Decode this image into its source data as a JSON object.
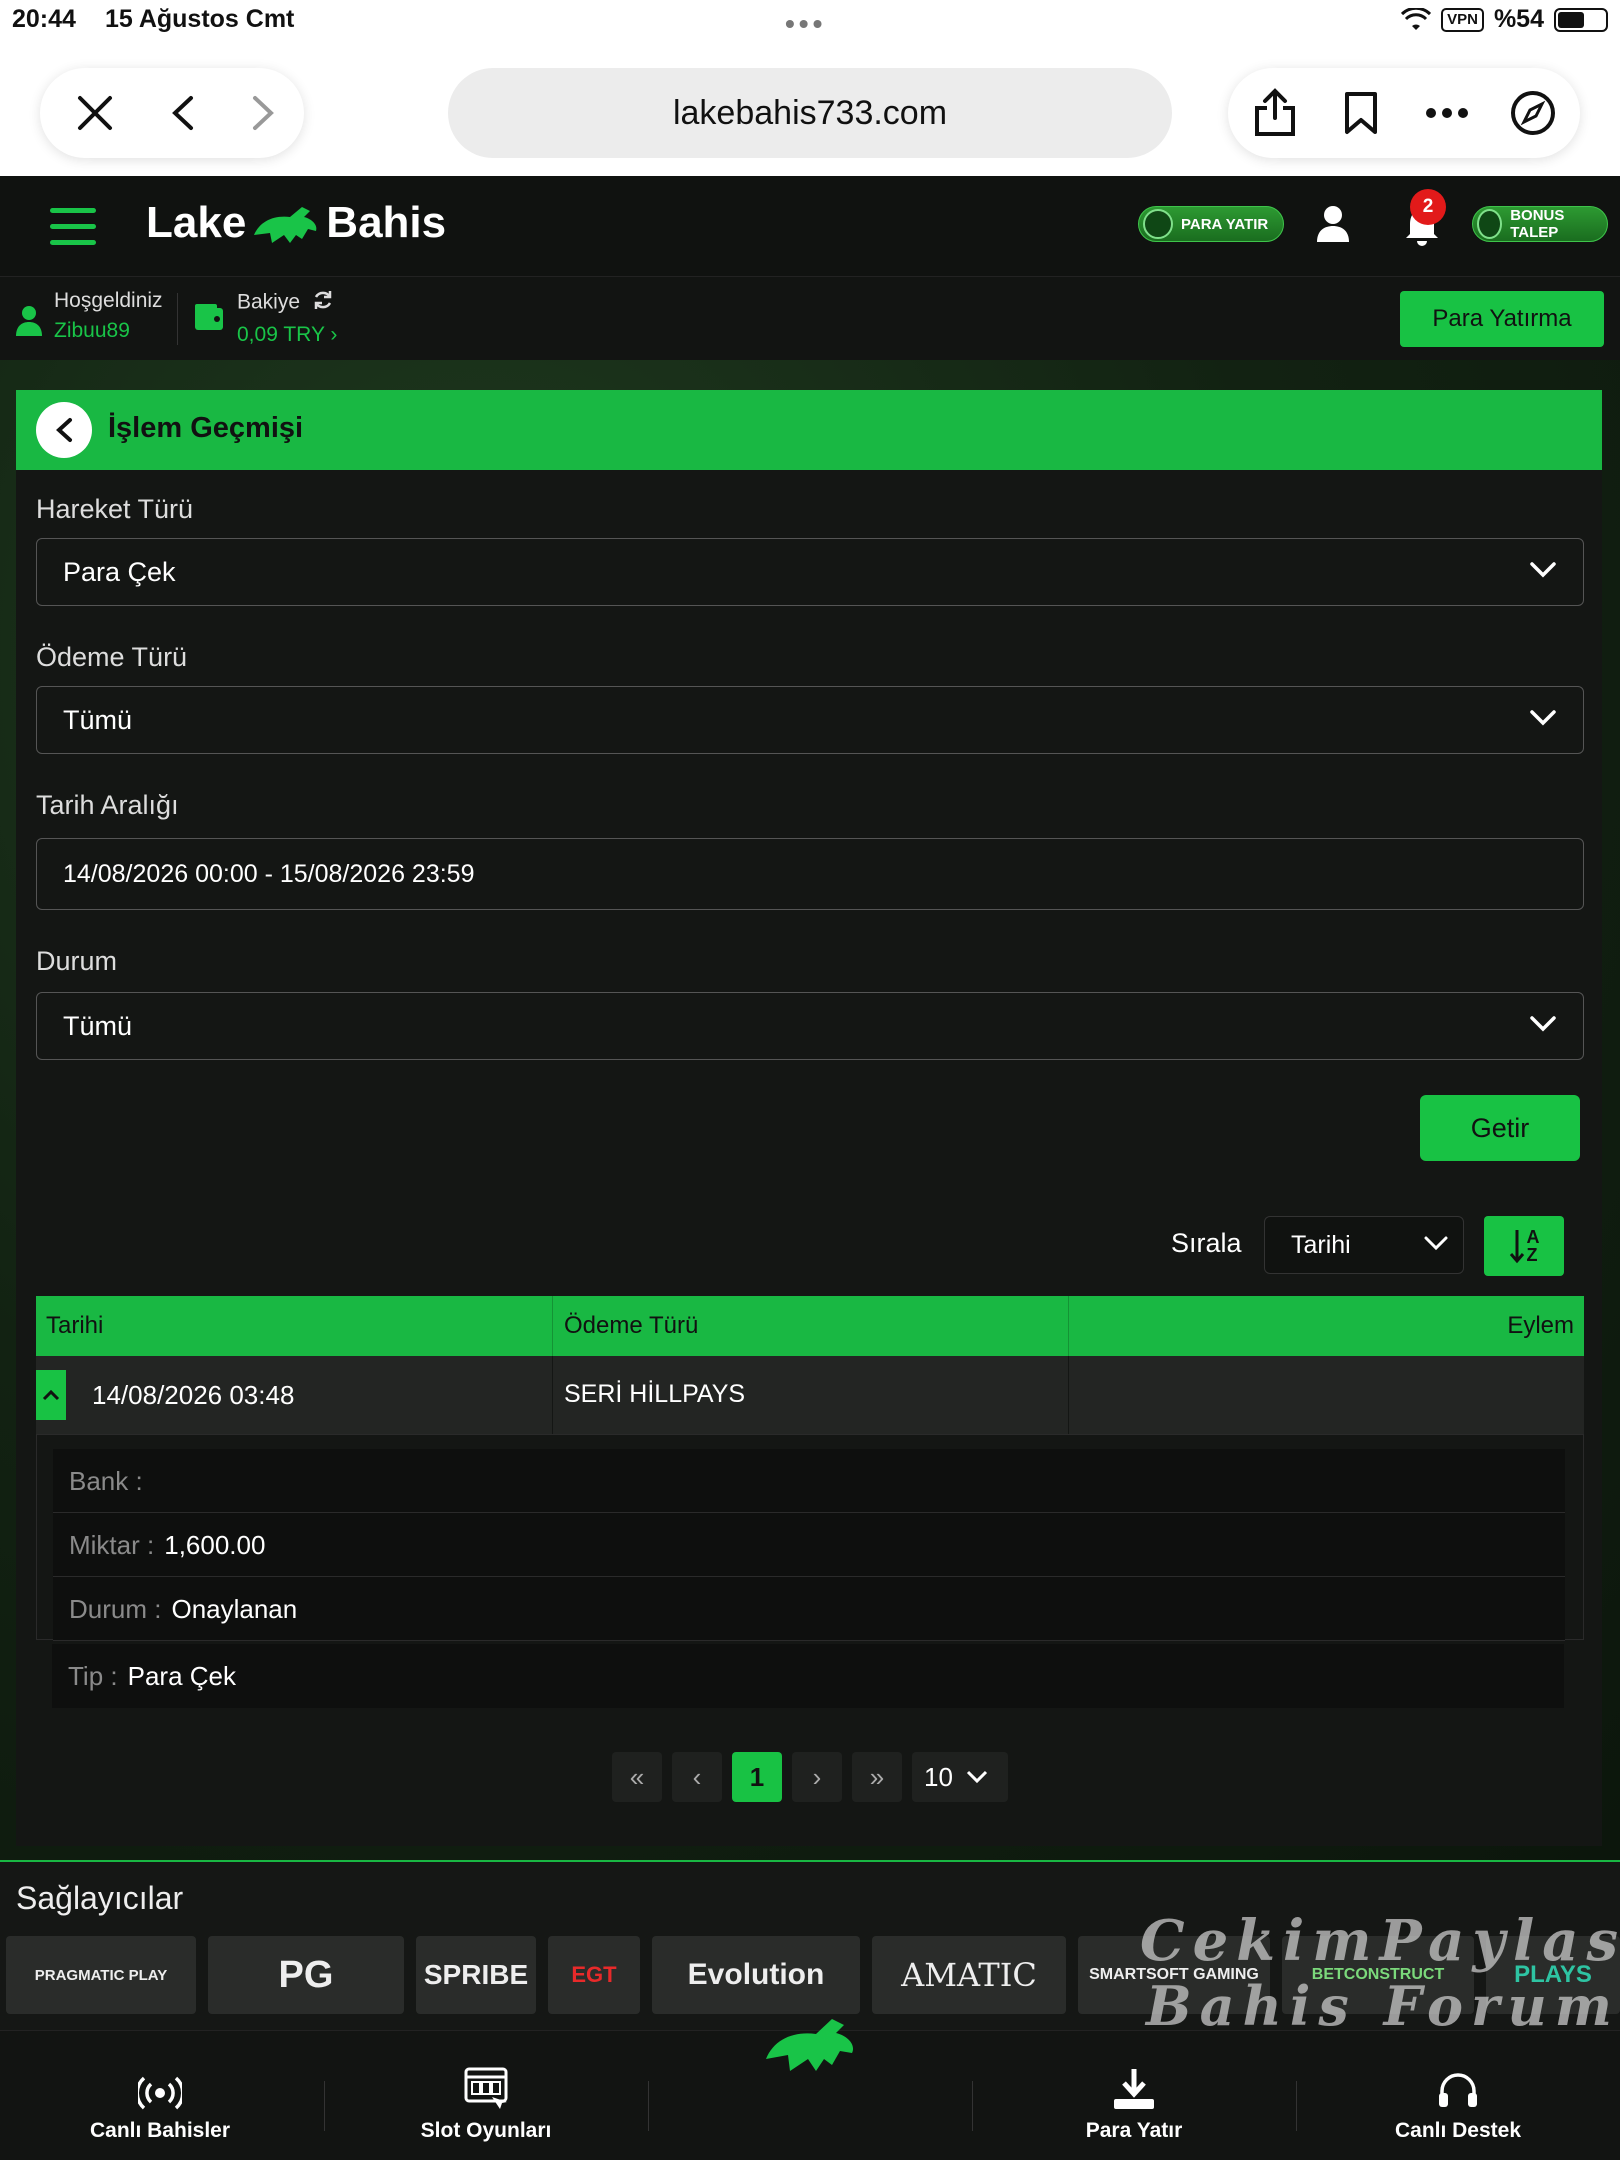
{
  "status": {
    "time": "20:44",
    "date": "15 Ağustos Cmt",
    "vpn": "VPN",
    "battery": "%54"
  },
  "browser": {
    "url": "lakebahis733.com"
  },
  "header": {
    "logo_left": "Lake",
    "logo_right": "Bahis",
    "para_yatir": "PARA YATIR",
    "notification_count": "2",
    "bonus_talep": "BONUS TALEP"
  },
  "userbar": {
    "welcome_label": "Hoşgeldiniz",
    "username": "Zibuu89",
    "balance_label": "Bakiye",
    "balance_value": "0,09 TRY",
    "deposit_button": "Para Yatırma"
  },
  "page": {
    "title": "İşlem Geçmişi",
    "filters": {
      "hareket_label": "Hareket Türü",
      "hareket_value": "Para Çek",
      "odeme_label": "Ödeme Türü",
      "odeme_value": "Tümü",
      "tarih_label": "Tarih Aralığı",
      "tarih_value": "14/08/2026 00:00 - 15/08/2026 23:59",
      "durum_label": "Durum",
      "durum_value": "Tümü",
      "submit": "Getir"
    },
    "sort": {
      "label": "Sırala",
      "value": "Tarihi",
      "icon_top": "A",
      "icon_bottom": "Z"
    },
    "table": {
      "headers": [
        "Tarihi",
        "Ödeme Türü",
        "Eylem"
      ],
      "row": {
        "date": "14/08/2026 03:48",
        "payment": "SERİ HİLLPAYS",
        "action": ""
      },
      "details": [
        {
          "key": "Bank :",
          "value": ""
        },
        {
          "key": "Miktar :",
          "value": "1,600.00"
        },
        {
          "key": "Durum :",
          "value": "Onaylanan"
        },
        {
          "key": "Tip :",
          "value": "Para Çek"
        }
      ]
    },
    "pagination": {
      "first": "«",
      "prev": "‹",
      "current": "1",
      "next": "›",
      "last": "»",
      "page_size": "10"
    }
  },
  "providers": {
    "title": "Sağlayıcılar",
    "items": [
      "PRAGMATIC PLAY",
      "PG",
      "SPRIBE",
      "EGT",
      "Evolution",
      "AMATIC",
      "SMARTSOFT GAMING",
      "BETCONSTRUCT",
      "PLAYS"
    ]
  },
  "watermark": {
    "line1": "CekimPaylas",
    "line2": "Bahis Forum"
  },
  "bottom_nav": {
    "live_bets": "Canlı Bahisler",
    "slots": "Slot Oyunları",
    "deposit": "Para Yatır",
    "support": "Canlı Destek"
  },
  "colors": {
    "accent": "#19c448",
    "header_bg": "#101210",
    "page_bg": "#141614",
    "badge": "#e21a1a"
  }
}
